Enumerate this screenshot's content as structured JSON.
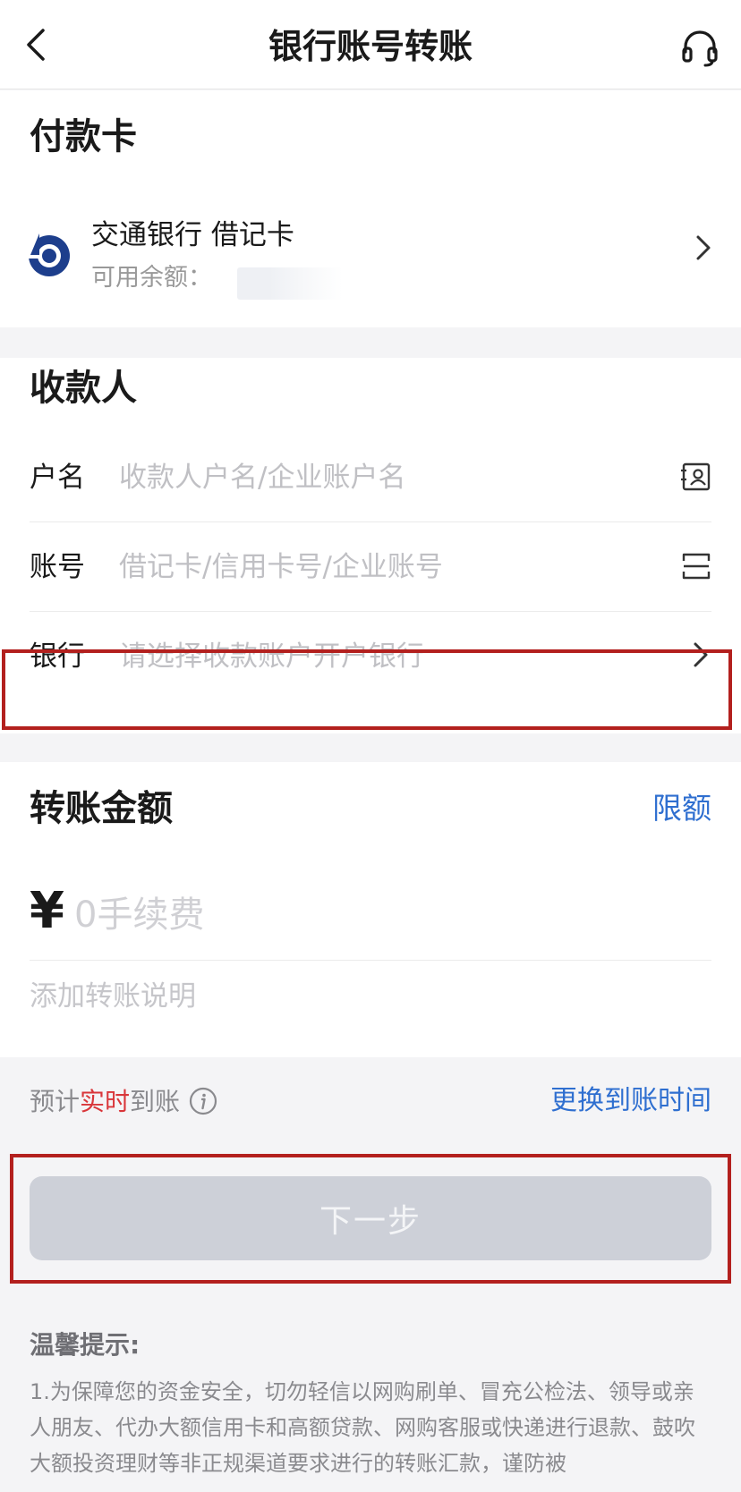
{
  "header": {
    "title": "银行账号转账",
    "back_icon": "chevron-left-icon",
    "service_icon": "headset-icon"
  },
  "payment_card": {
    "section_title": "付款卡",
    "bank_name": "交通银行  借记卡",
    "balance_label": "可用余额：",
    "bank_logo_icon": "bocom-logo-icon",
    "logo_color": "#1d3e8c"
  },
  "payee": {
    "section_title": "收款人",
    "name_label": "户名",
    "name_placeholder": "收款人户名/企业账户名",
    "account_label": "账号",
    "account_placeholder": "借记卡/信用卡号/企业账号",
    "bank_label": "银行",
    "bank_placeholder": "请选择收款账户开户银行",
    "contact_icon": "contact-book-icon",
    "scan_icon": "scan-icon"
  },
  "amount": {
    "section_title": "转账金额",
    "limit_link": "限额",
    "currency_symbol": "¥",
    "amount_placeholder": "0手续费",
    "remark_placeholder": "添加转账说明"
  },
  "arrival": {
    "prefix": "预计",
    "highlight": "实时",
    "suffix": "到账",
    "change_link": "更换到账时间"
  },
  "next_button": "下一步",
  "tips": {
    "title": "温馨提示:",
    "body": "1.为保障您的资金安全，切勿轻信以网购刷单、冒充公检法、领导或亲人朋友、代办大额信用卡和高额贷款、网购客服或快递进行退款、鼓吹大额投资理财等非正规渠道要求进行的转账汇款，谨防被"
  },
  "colors": {
    "accent_blue": "#2f6fd0",
    "highlight_red": "#d9363a",
    "annotation_red": "#b3201e",
    "button_disabled": "#cdd0d8"
  }
}
